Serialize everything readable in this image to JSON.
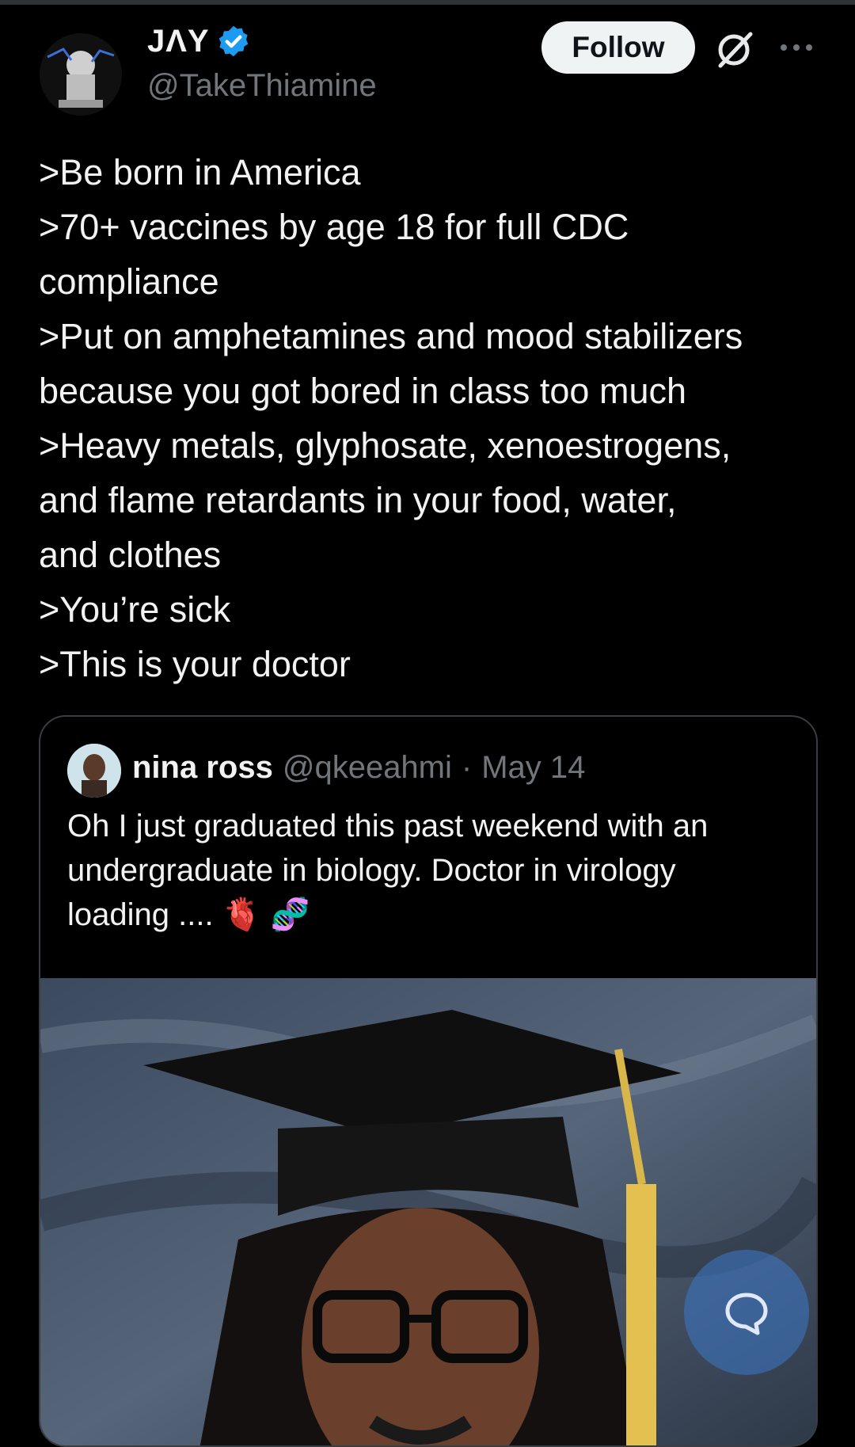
{
  "author": {
    "name": "JΛY",
    "handle": "@TakeThiamine",
    "verified": true,
    "verified_color": "#1d9bf0"
  },
  "actions": {
    "follow_label": "Follow",
    "grok_icon": "grok-icon",
    "more_icon": "more-icon"
  },
  "tweet": {
    "lines": [
      ">Be born in America",
      ">70+ vaccines by age 18 for full CDC",
      "compliance",
      ">Put on amphetamines and mood stabilizers",
      "because you got bored in class too much",
      ">Heavy metals, glyphosate, xenoestrogens,",
      "and flame retardants in your food, water,",
      "and clothes",
      ">You’re sick",
      ">This is your doctor"
    ]
  },
  "quote": {
    "name": "nina ross",
    "handle": "@qkeeahmi",
    "separator": "·",
    "date": "May 14",
    "lines": [
      "Oh I just graduated this past weekend with an",
      "undergraduate in biology.  Doctor in virology",
      "loading .... 🫀 🧬"
    ]
  },
  "fab": {
    "icon": "reply-bubble-icon",
    "color": "#3c78c8"
  }
}
